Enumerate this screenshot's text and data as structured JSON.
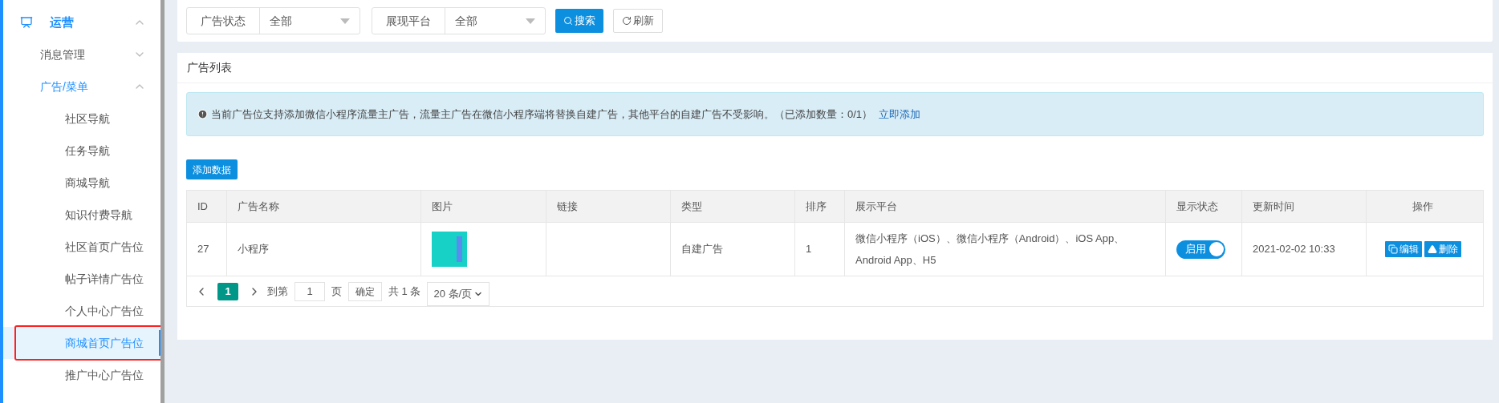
{
  "sidebar": {
    "items": [
      {
        "label": "运营",
        "expanded": true,
        "children": [
          {
            "label": "消息管理",
            "expanded": false
          },
          {
            "label": "广告/菜单",
            "expanded": true,
            "children": [
              {
                "label": "社区导航",
                "selected": false,
                "annotated": false
              },
              {
                "label": "任务导航",
                "selected": false,
                "annotated": false
              },
              {
                "label": "商城导航",
                "selected": false,
                "annotated": false
              },
              {
                "label": "知识付费导航",
                "selected": false,
                "annotated": false
              },
              {
                "label": "社区首页广告位",
                "selected": false,
                "annotated": false
              },
              {
                "label": "帖子详情广告位",
                "selected": false,
                "annotated": false
              },
              {
                "label": "个人中心广告位",
                "selected": false,
                "annotated": false
              },
              {
                "label": "商城首页广告位",
                "selected": true,
                "annotated": true
              },
              {
                "label": "推广中心广告位",
                "selected": false,
                "annotated": false
              }
            ]
          }
        ]
      }
    ]
  },
  "filters": [
    {
      "label": "广告状态",
      "value": "全部"
    },
    {
      "label": "展现平台",
      "value": "全部"
    }
  ],
  "filter_buttons": [
    {
      "kind": "search",
      "label": "搜索"
    },
    {
      "kind": "refresh",
      "label": "刷新"
    }
  ],
  "list": {
    "title": "广告列表",
    "notice": {
      "text": "当前广告位支持添加微信小程序流量主广告，流量主广告在微信小程序端将替换自建广告，其他平台的自建广告不受影响。（已添加数量：0/1）",
      "link": "立即添加"
    },
    "add_button": "添加数据",
    "columns": [
      "ID",
      "广告名称",
      "图片",
      "链接",
      "类型",
      "排序",
      "展示平台",
      "显示状态",
      "更新时间",
      "操作"
    ],
    "rows": [
      {
        "id": "27",
        "name": "小程序",
        "type": "自建广告",
        "order": "1",
        "platform": "微信小程序（iOS）、微信小程序（Android）、iOS App、Android App、H5",
        "status": {
          "label": "启用",
          "on": true
        },
        "updated": "2021-02-02 10:33",
        "actions": [
          {
            "kind": "edit",
            "label": "编辑"
          },
          {
            "kind": "delete",
            "label": "删除"
          }
        ]
      }
    ],
    "pagination": {
      "pages": [
        {
          "label": "1",
          "selected": true
        }
      ],
      "goto_label": "到第",
      "goto_value": "1",
      "page_label": "页",
      "confirm": "确定",
      "total": "共 1 条",
      "page_size": "20 条/页"
    }
  }
}
